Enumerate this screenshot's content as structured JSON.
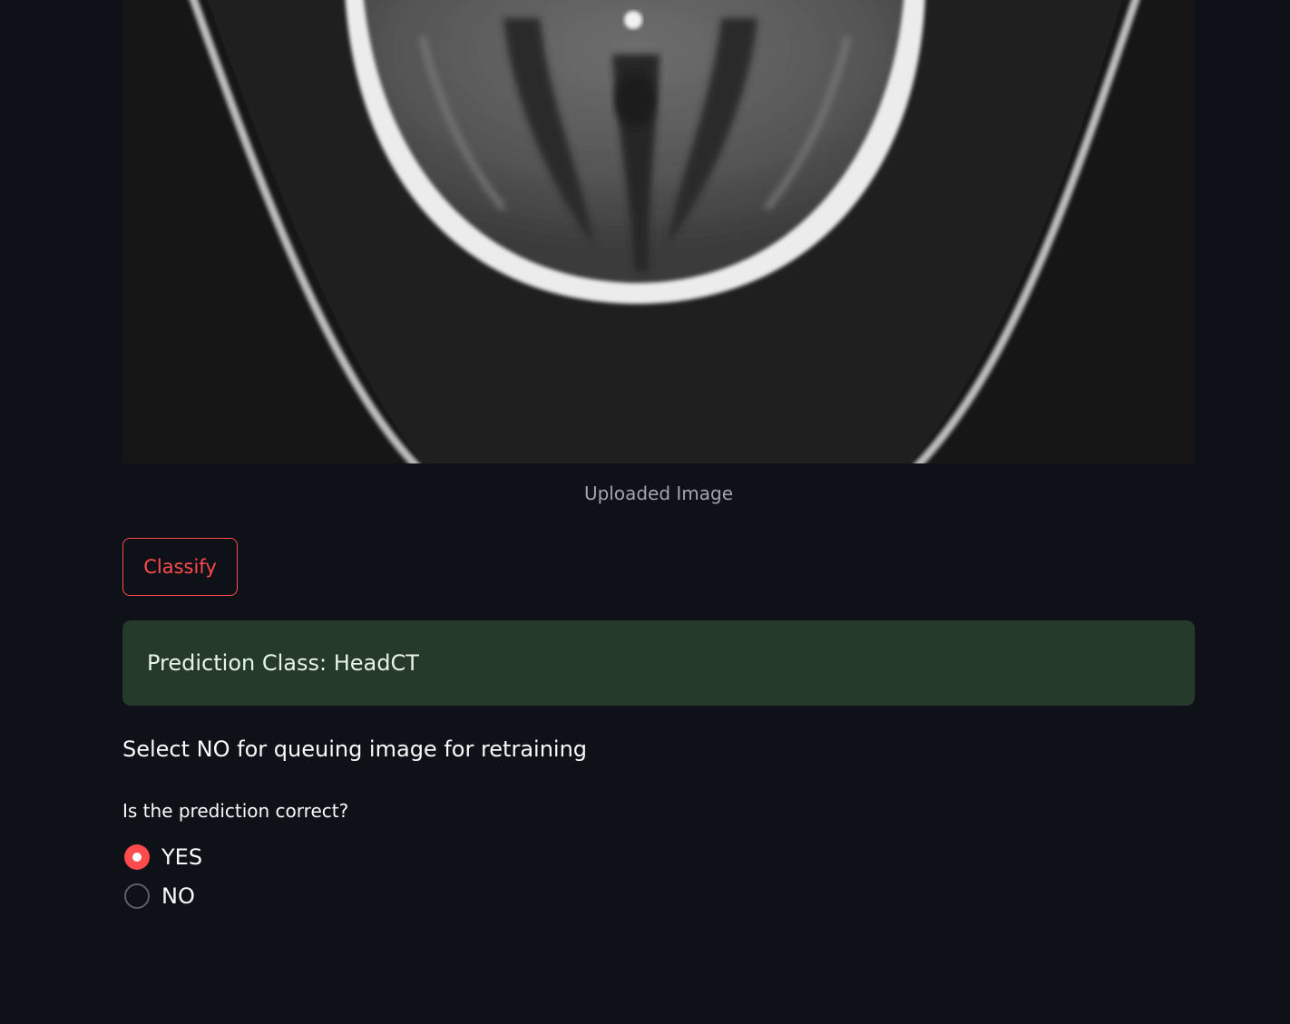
{
  "image": {
    "caption": "Uploaded Image",
    "depicts": "head CT scan slice"
  },
  "classify_button": {
    "label": "Classify"
  },
  "prediction": {
    "text": "Prediction Class: HeadCT"
  },
  "retrain_note": {
    "text": "Select NO for queuing image for retraining"
  },
  "feedback": {
    "question": "Is the prediction correct?",
    "options": [
      {
        "label": "YES",
        "selected": true
      },
      {
        "label": "NO",
        "selected": false
      }
    ]
  },
  "colors": {
    "background": "#0e1117",
    "accent": "#ff4b4b",
    "success_bg": "#253a2b"
  }
}
